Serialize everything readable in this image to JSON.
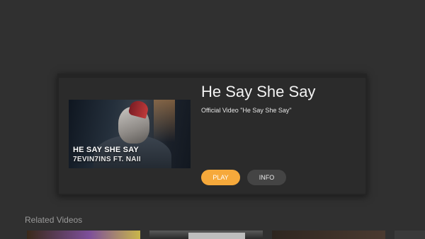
{
  "video": {
    "title": "He Say She Say",
    "description": "Official Video \"He Say She Say\"",
    "thumbnail": {
      "overlay_title": "HE SAY SHE SAY",
      "overlay_subtitle": "7EVIN7INS FT. NAII"
    }
  },
  "actions": {
    "play_label": "PLAY",
    "info_label": "INFO"
  },
  "related": {
    "heading": "Related Videos"
  },
  "colors": {
    "background": "#303030",
    "card": "#2b2b2b",
    "play_accent": "#f6a93b",
    "info_button": "#444444"
  }
}
